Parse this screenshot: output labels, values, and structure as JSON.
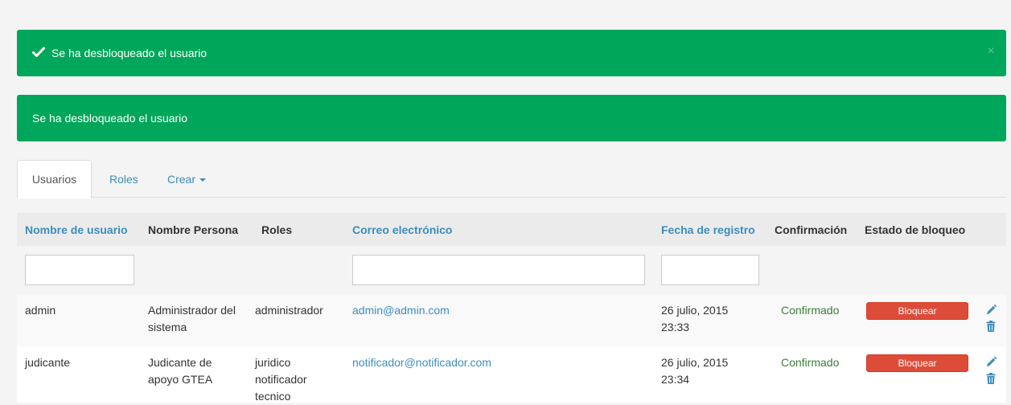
{
  "alerts": [
    {
      "message": "Se ha desbloqueado el usuario",
      "close": "×"
    },
    {
      "message": "Se ha desbloqueado el usuario"
    }
  ],
  "tabs": {
    "usuarios": "Usuarios",
    "roles": "Roles",
    "crear": "Crear"
  },
  "table": {
    "headers": {
      "username": "Nombre de usuario",
      "person": "Nombre Persona",
      "roles": "Roles",
      "email": "Correo electrónico",
      "date": "Fecha de registro",
      "confirmation": "Confirmación",
      "block_state": "Estado de bloqueo"
    },
    "filters": {
      "username": "",
      "email": "",
      "date": ""
    },
    "rows": [
      {
        "username": "admin",
        "person_line1": "Administrador del",
        "person_line2": "sistema",
        "roles_line1": "administrador",
        "roles_line2": "",
        "roles_line3": "",
        "email": "admin@admin.com",
        "date_line1": "26 julio, 2015",
        "date_line2": "23:33",
        "confirmation": "Confirmado",
        "action": "Bloquear"
      },
      {
        "username": "judicante",
        "person_line1": "Judicante de",
        "person_line2": "apoyo GTEA",
        "roles_line1": "juridico",
        "roles_line2": "notificador",
        "roles_line3": "tecnico",
        "email": "notificador@notificador.com",
        "date_line1": "26 julio, 2015",
        "date_line2": "23:34",
        "confirmation": "Confirmado",
        "action": "Bloquear"
      }
    ]
  },
  "colors": {
    "success": "#00a65a",
    "link": "#3c8dbc",
    "danger": "#dd4b39"
  },
  "icons": [
    "check-icon",
    "close-icon",
    "caret-down-icon",
    "pencil-icon",
    "trash-icon"
  ]
}
